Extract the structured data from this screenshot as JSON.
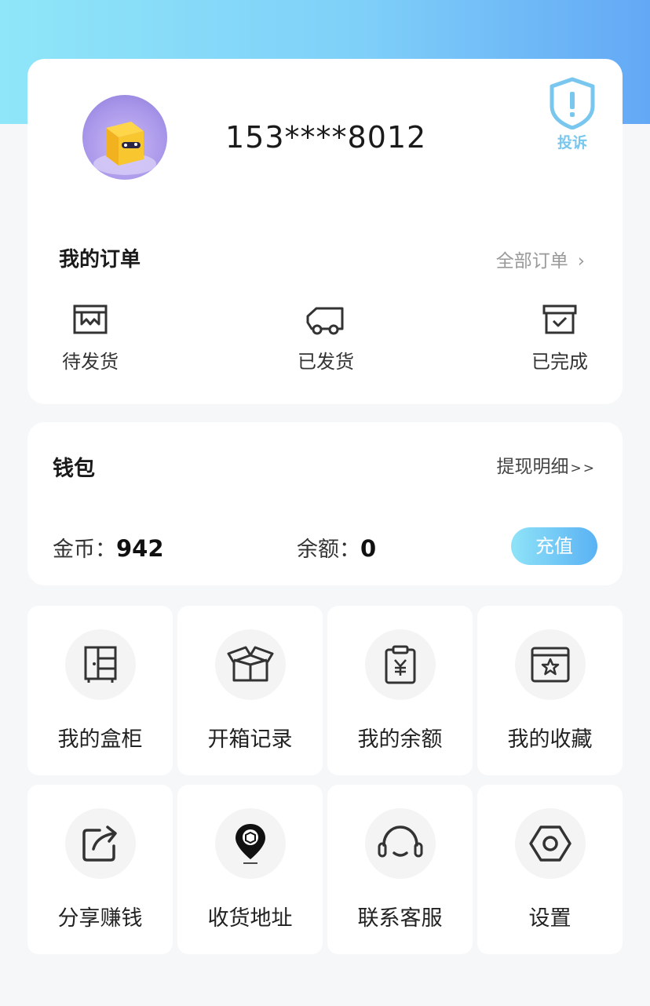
{
  "profile": {
    "phone": "153****8012",
    "complain_label": "投诉"
  },
  "orders": {
    "title": "我的订单",
    "all_label": "全部订单",
    "chevron": "›",
    "items": [
      {
        "label": "待发货",
        "icon": "pending-shipment-icon"
      },
      {
        "label": "已发货",
        "icon": "truck-icon"
      },
      {
        "label": "已完成",
        "icon": "completed-box-icon"
      }
    ]
  },
  "wallet": {
    "title": "钱包",
    "detail_label": "提现明细",
    "detail_suffix": ">>",
    "coin_label": "金币：",
    "coin_value": "942",
    "balance_label": "余额：",
    "balance_value": "0",
    "recharge_label": "充值"
  },
  "menu": [
    {
      "label": "我的盒柜",
      "icon": "cabinet-icon"
    },
    {
      "label": "开箱记录",
      "icon": "open-box-icon"
    },
    {
      "label": "我的余额",
      "icon": "yuan-clipboard-icon"
    },
    {
      "label": "我的收藏",
      "icon": "star-box-icon"
    },
    {
      "label": "分享赚钱",
      "icon": "share-icon"
    },
    {
      "label": "收货地址",
      "icon": "location-pin-icon"
    },
    {
      "label": "联系客服",
      "icon": "headset-icon"
    },
    {
      "label": "设置",
      "icon": "settings-hexagon-icon"
    }
  ],
  "colors": {
    "header_gradient_start": "#8fe6f8",
    "header_gradient_end": "#63a8f5",
    "accent": "#79c7ef"
  }
}
